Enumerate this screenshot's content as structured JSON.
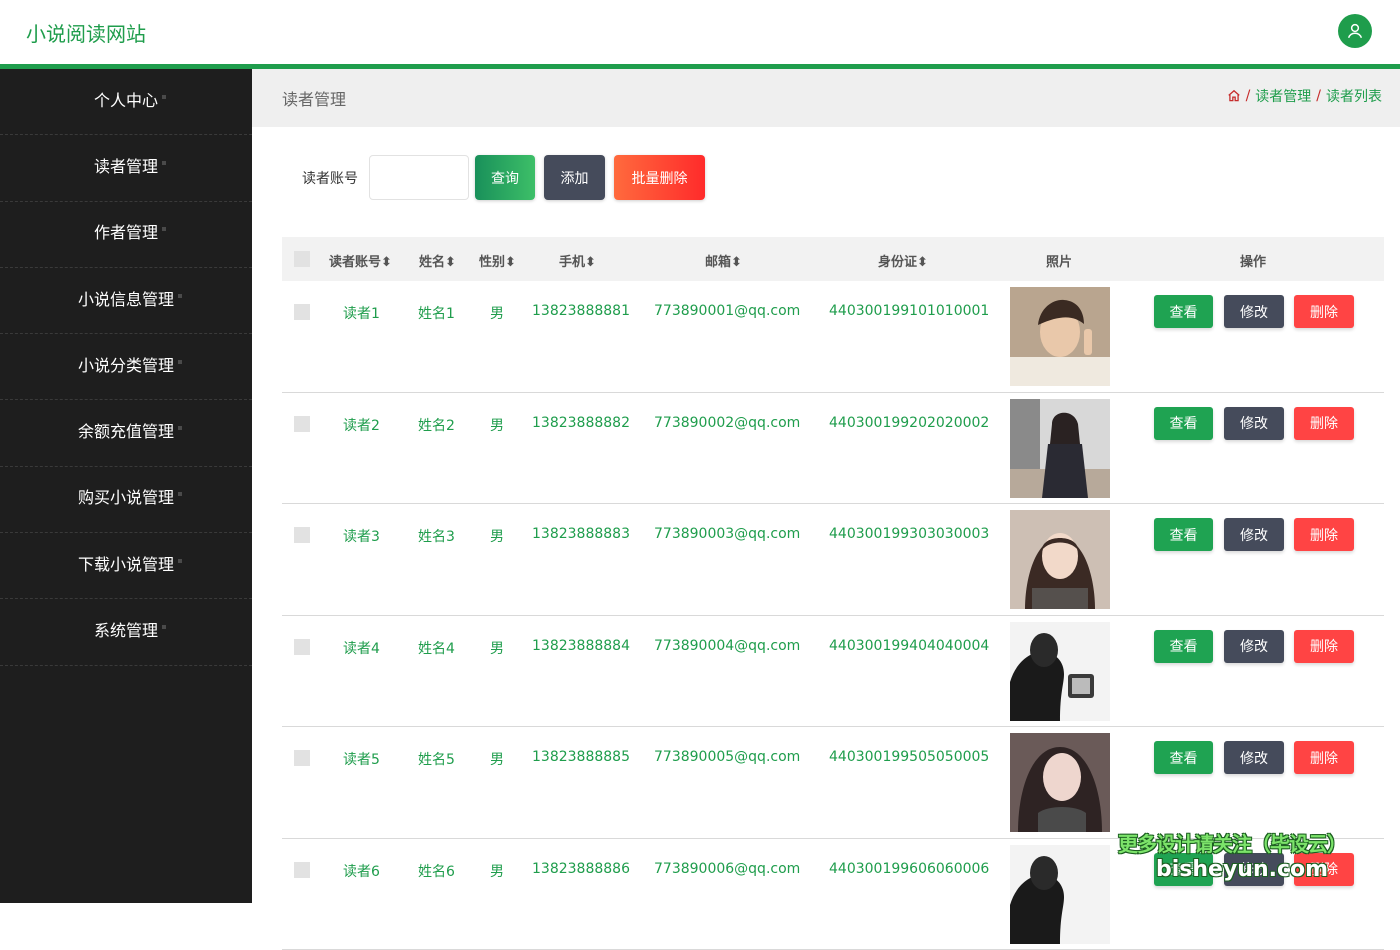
{
  "header": {
    "site_title": "小说阅读网站",
    "user_icon": "user-icon"
  },
  "sidebar": {
    "items": [
      "个人中心",
      "读者管理",
      "作者管理",
      "小说信息管理",
      "小说分类管理",
      "余额充值管理",
      "购买小说管理",
      "下载小说管理",
      "系统管理"
    ]
  },
  "page": {
    "title": "读者管理",
    "breadcrumb": {
      "home_icon": "home-icon",
      "sep": "/",
      "level1": "读者管理",
      "level2": "读者列表"
    }
  },
  "search": {
    "label": "读者账号",
    "input_value": "",
    "query_label": "查询",
    "add_label": "添加",
    "batch_delete_label": "批量删除"
  },
  "table": {
    "headers": [
      "读者账号",
      "姓名",
      "性别",
      "手机",
      "邮箱",
      "身份证",
      "照片",
      "操作"
    ],
    "sort_icon": "sort-icon",
    "rows": [
      {
        "account": "读者1",
        "name": "姓名1",
        "gender": "男",
        "phone": "13823888881",
        "email": "773890001@qq.com",
        "idcard": "440300199101010001"
      },
      {
        "account": "读者2",
        "name": "姓名2",
        "gender": "男",
        "phone": "13823888882",
        "email": "773890002@qq.com",
        "idcard": "440300199202020002"
      },
      {
        "account": "读者3",
        "name": "姓名3",
        "gender": "男",
        "phone": "13823888883",
        "email": "773890003@qq.com",
        "idcard": "440300199303030003"
      },
      {
        "account": "读者4",
        "name": "姓名4",
        "gender": "男",
        "phone": "13823888884",
        "email": "773890004@qq.com",
        "idcard": "440300199404040004"
      },
      {
        "account": "读者5",
        "name": "姓名5",
        "gender": "男",
        "phone": "13823888885",
        "email": "773890005@qq.com",
        "idcard": "440300199505050005"
      },
      {
        "account": "读者6",
        "name": "姓名6",
        "gender": "男",
        "phone": "13823888886",
        "email": "773890006@qq.com",
        "idcard": "440300199606060006"
      }
    ],
    "actions": {
      "view": "查看",
      "edit": "修改",
      "delete": "删除"
    }
  },
  "watermark": {
    "line1": "更多设计请关注（毕设云）",
    "line2": "bisheyun.com"
  },
  "colors": {
    "brand": "#1f9d4c",
    "sidebar_bg": "#1e1e1e",
    "danger": "#ff4444",
    "dark_button": "#454b5b"
  }
}
